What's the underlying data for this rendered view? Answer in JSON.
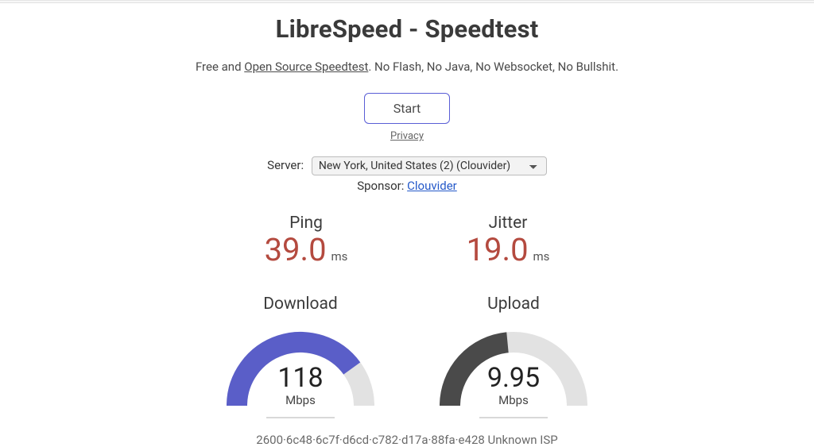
{
  "header": {
    "title": "LibreSpeed - Speedtest",
    "tagline_prefix": "Free and ",
    "oss_link_text": "Open Source Speedtest",
    "tagline_suffix": ". No Flash, No Java, No Websocket, No Bullshit."
  },
  "controls": {
    "start_label": "Start",
    "privacy_label": "Privacy",
    "server_label": "Server:",
    "server_selected": "New York, United States (2) (Clouvider)",
    "sponsor_label": "Sponsor: ",
    "sponsor_name": "Clouvider"
  },
  "metrics": {
    "ping_label": "Ping",
    "ping_value": "39.0",
    "ping_unit": "ms",
    "jitter_label": "Jitter",
    "jitter_value": "19.0",
    "jitter_unit": "ms"
  },
  "gauges": {
    "download": {
      "label": "Download",
      "value": "118",
      "unit": "Mbps",
      "progress": 0.8,
      "color": "#5a5ec8",
      "track": "#e2e2e2"
    },
    "upload": {
      "label": "Upload",
      "value": "9.95",
      "unit": "Mbps",
      "progress": 0.47,
      "color": "#4a4a4a",
      "track": "#e2e2e2"
    }
  },
  "footer": {
    "ip_line": "2600·6c48·6c7f·d6cd·c782·d17a·88fa·e428   Unknown ISP"
  }
}
